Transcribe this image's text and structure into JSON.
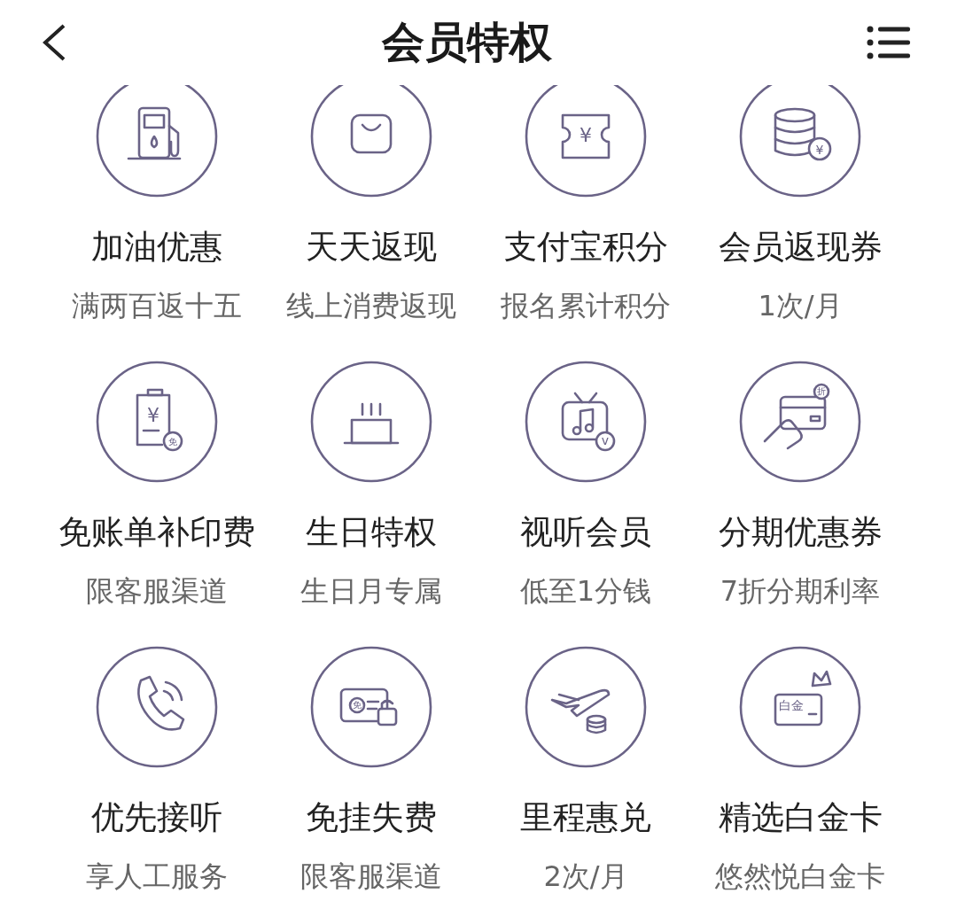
{
  "header": {
    "title": "会员特权"
  },
  "items": [
    {
      "title": "加油优惠",
      "subtitle": "满两百返十五"
    },
    {
      "title": "天天返现",
      "subtitle": "线上消费返现"
    },
    {
      "icon_texts": [
        "¥"
      ],
      "title": "支付宝积分",
      "subtitle": "报名累计积分"
    },
    {
      "icon_texts": [
        "¥"
      ],
      "title": "会员返现券",
      "subtitle": "1次/月"
    },
    {
      "icon_texts": [
        "¥",
        "免"
      ],
      "title": "免账单补印费",
      "subtitle": "限客服渠道"
    },
    {
      "title": "生日特权",
      "subtitle": "生日月专属"
    },
    {
      "icon_texts": [
        "v"
      ],
      "title": "视听会员",
      "subtitle": "低至1分钱"
    },
    {
      "icon_texts": [
        "折"
      ],
      "title": "分期优惠券",
      "subtitle": "7折分期利率"
    },
    {
      "title": "优先接听",
      "subtitle": "享人工服务"
    },
    {
      "icon_texts": [
        "免"
      ],
      "title": "免挂失费",
      "subtitle": "限客服渠道"
    },
    {
      "title": "里程惠兑",
      "subtitle": "2次/月"
    },
    {
      "icon_texts": [
        "白金"
      ],
      "title": "精选白金卡",
      "subtitle": "悠然悦白金卡"
    }
  ]
}
